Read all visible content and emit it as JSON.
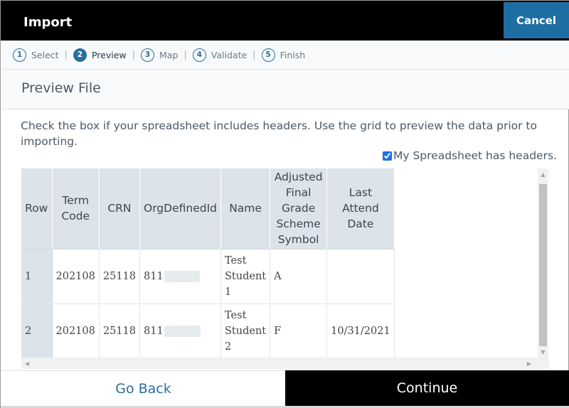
{
  "dialog": {
    "title": "Import",
    "cancel_label": "Cancel"
  },
  "steps": [
    {
      "num": "1",
      "label": "Select",
      "active": false
    },
    {
      "num": "2",
      "label": "Preview",
      "active": true
    },
    {
      "num": "3",
      "label": "Map",
      "active": false
    },
    {
      "num": "4",
      "label": "Validate",
      "active": false
    },
    {
      "num": "5",
      "label": "Finish",
      "active": false
    }
  ],
  "step_separator": "|",
  "section_title": "Preview File",
  "instructions": "Check the box if your spreadsheet includes headers. Use the grid to preview the data prior to importing.",
  "headers_checkbox": {
    "label": "My Spreadsheet has headers.",
    "checked": true
  },
  "grid": {
    "columns": [
      "Row",
      "Term Code",
      "CRN",
      "OrgDefinedId",
      "Name",
      "Adjusted Final Grade Scheme Symbol",
      "Last Attend Date"
    ],
    "rows": [
      {
        "row": "1",
        "term_code": "202108",
        "crn": "25118",
        "org_defined_id": "811",
        "name": "Test Student 1",
        "grade_symbol": "A",
        "last_attend_date": ""
      },
      {
        "row": "2",
        "term_code": "202108",
        "crn": "25118",
        "org_defined_id": "811",
        "name": "Test Student 2",
        "grade_symbol": "F",
        "last_attend_date": "10/31/2021"
      }
    ]
  },
  "footer": {
    "back_label": "Go Back",
    "continue_label": "Continue"
  },
  "colors": {
    "header_bg": "#000000",
    "cancel_bg": "#1f6ea3",
    "accent": "#2a6e9e",
    "grid_header_bg": "#dce4ea"
  }
}
